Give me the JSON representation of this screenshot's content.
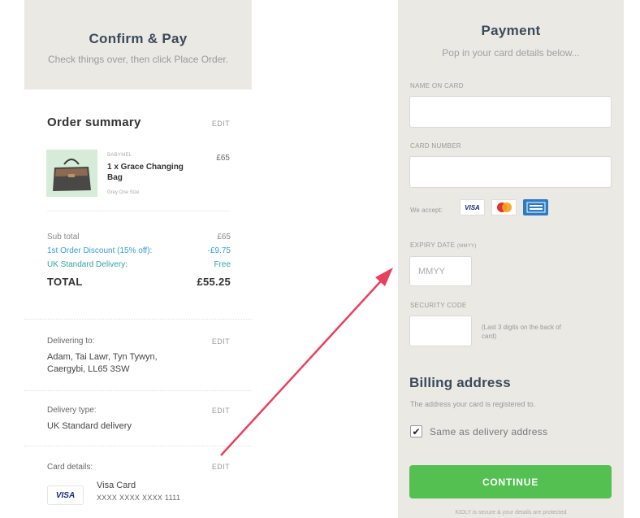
{
  "confirm": {
    "title": "Confirm & Pay",
    "subtitle": "Check things over, then click Place Order."
  },
  "order": {
    "title": "Order summary",
    "edit": "EDIT",
    "item": {
      "brand": "BABYMEL",
      "name": "1 x Grace Changing Bag",
      "variant": "Grey One Size",
      "price": "£65"
    },
    "subtotal_label": "Sub total",
    "subtotal_value": "£65",
    "discount_label": "1st Order Discount (15% off):",
    "discount_value": "-£9.75",
    "delivery_label": "UK Standard Delivery:",
    "delivery_value": "Free",
    "total_label": "TOTAL",
    "total_value": "£55.25"
  },
  "delivering": {
    "label": "Delivering to:",
    "edit": "EDIT",
    "line1": "Adam, Tai Lawr, Tyn Tywyn,",
    "line2": "Caergybi, LL65 3SW"
  },
  "delivery_type": {
    "label": "Delivery type:",
    "edit": "EDIT",
    "value": "UK Standard delivery"
  },
  "card_details": {
    "label": "Card details:",
    "edit": "EDIT",
    "brand": "VISA",
    "name": "Visa Card",
    "number": "XXXX XXXX XXXX 1111"
  },
  "payment": {
    "title": "Payment",
    "subtitle": "Pop in your card details below...",
    "name_label": "NAME ON CARD",
    "number_label": "CARD NUMBER",
    "accept_label": "We accept:",
    "visa": "VISA",
    "expiry_label": "EXPIRY DATE",
    "expiry_format": "(MMYY)",
    "expiry_placeholder": "MMYY",
    "security_label": "SECURITY CODE",
    "security_hint": "(Last 3 digits on the back of card)",
    "billing_title": "Billing address",
    "billing_sub": "The address your card is registered to.",
    "same_address": "Same as delivery address",
    "continue": "CONTINUE",
    "secure_note": "KIDLY is secure & your details are protected"
  },
  "colors": {
    "accent_green": "#55c052",
    "discount_blue": "#3b9bd6",
    "delivery_teal": "#2fa6a0",
    "arrow_red": "#e6415f",
    "panel_bg": "#ebe9e4"
  }
}
